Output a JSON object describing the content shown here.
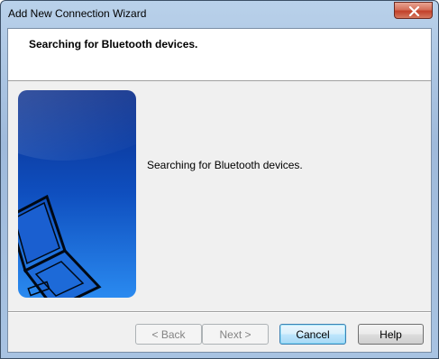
{
  "window": {
    "title": "Add New Connection Wizard"
  },
  "header": {
    "title": "Searching for Bluetooth devices."
  },
  "main": {
    "status_text": "Searching for Bluetooth devices."
  },
  "buttons": {
    "back": "< Back",
    "next": "Next >",
    "cancel": "Cancel",
    "help": "Help"
  },
  "icons": {
    "close": "close-icon",
    "side_art": "laptop-illustration"
  },
  "colors": {
    "side_art_top": "#0a2d8a",
    "side_art_bottom": "#1e7be6"
  }
}
